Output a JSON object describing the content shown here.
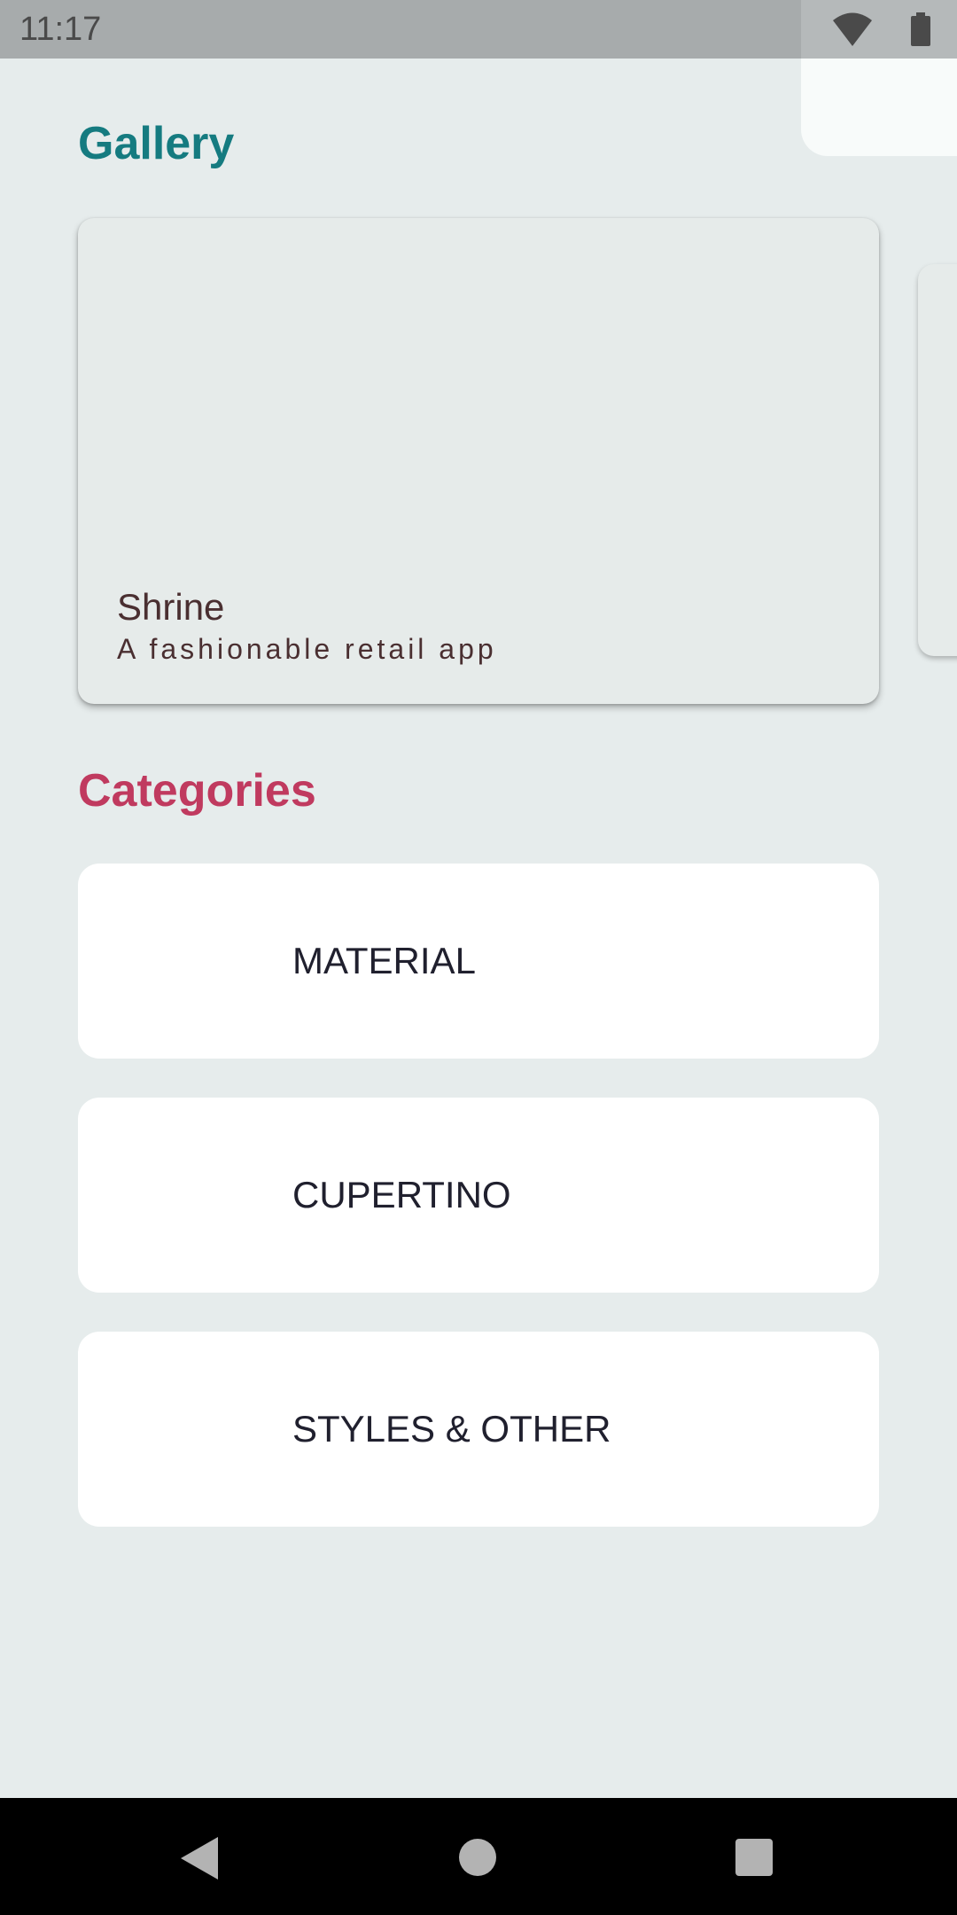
{
  "status_bar": {
    "time": "11:17",
    "icons": [
      "wifi-icon",
      "battery-icon"
    ]
  },
  "gallery": {
    "title": "Gallery",
    "card": {
      "title": "Shrine",
      "subtitle": "A fashionable retail app"
    }
  },
  "categories": {
    "title": "Categories",
    "items": [
      {
        "label": "MATERIAL"
      },
      {
        "label": "CUPERTINO"
      },
      {
        "label": "STYLES & OTHER"
      }
    ]
  },
  "nav_bar": {
    "icons": [
      "back-icon",
      "home-icon",
      "recents-icon"
    ]
  },
  "colors": {
    "background": "#e6ecec",
    "gallery_title": "#157b80",
    "categories_title": "#c03a5f",
    "card_text": "#4a2f31",
    "category_text": "#20202e"
  }
}
